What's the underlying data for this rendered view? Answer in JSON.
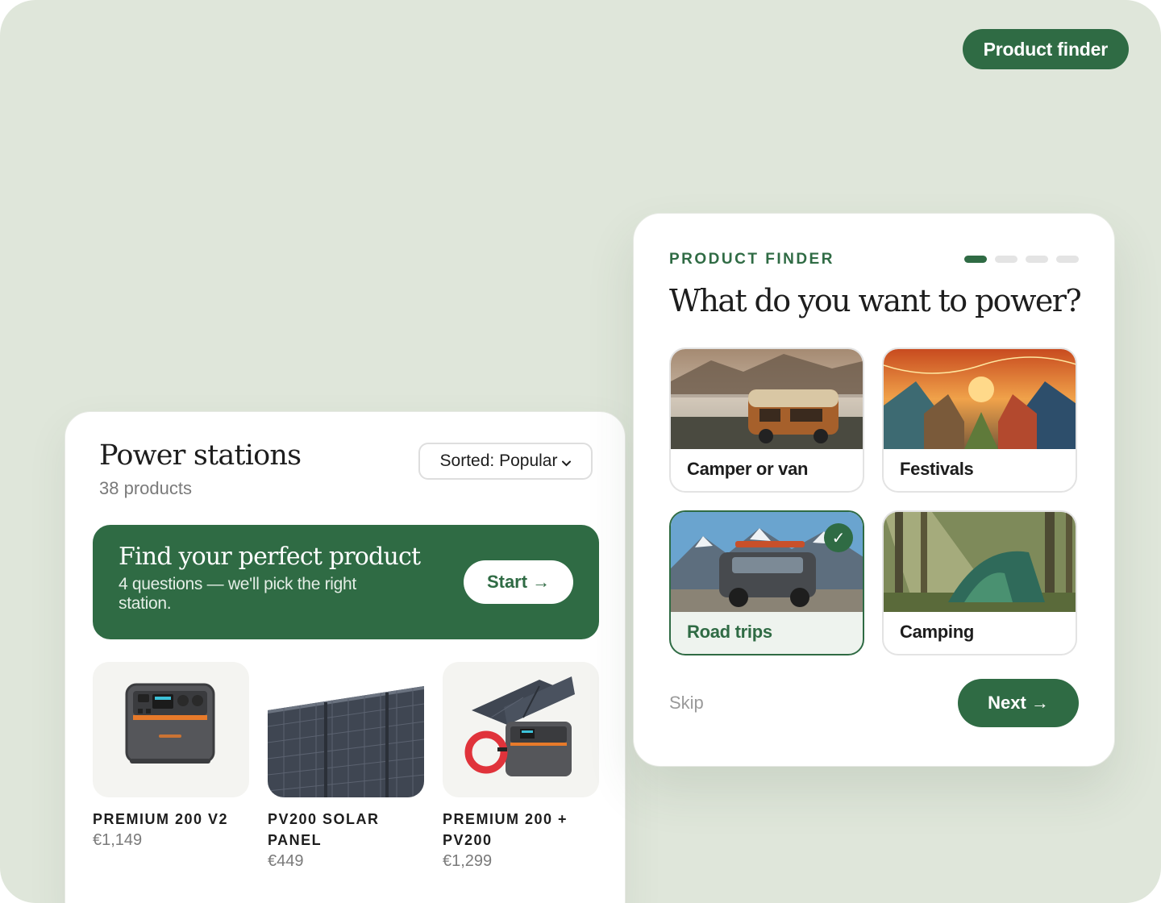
{
  "header": {
    "finder_pill": "Product finder"
  },
  "listing": {
    "title": "Power stations",
    "count": "38 products",
    "sort_label": "Sorted: Popular",
    "sort_icon": "chevron-down-icon",
    "banner": {
      "title": "Find your perfect product",
      "subtitle": "4 questions — we'll pick the right station.",
      "start_label": "Start",
      "arrow": "→"
    },
    "products": [
      {
        "name": "PREMIUM 200 V2",
        "price": "€1,149"
      },
      {
        "name": "PV200 SOLAR PANEL",
        "price": "€449"
      },
      {
        "name": "PREMIUM 200 + PV200",
        "price": "€1,299"
      }
    ]
  },
  "finder": {
    "eyebrow": "PRODUCT FINDER",
    "question": "What do you want to power?",
    "steps_total": 4,
    "step_current": 1,
    "options": [
      {
        "label": "Camper or van",
        "selected": false
      },
      {
        "label": "Festivals",
        "selected": false
      },
      {
        "label": "Road trips",
        "selected": true
      },
      {
        "label": "Camping",
        "selected": false
      }
    ],
    "check_glyph": "✓",
    "skip_label": "Skip",
    "next_label": "Next",
    "arrow": "→"
  },
  "colors": {
    "brand_green": "#2f6b44",
    "background": "#dfe6da"
  }
}
